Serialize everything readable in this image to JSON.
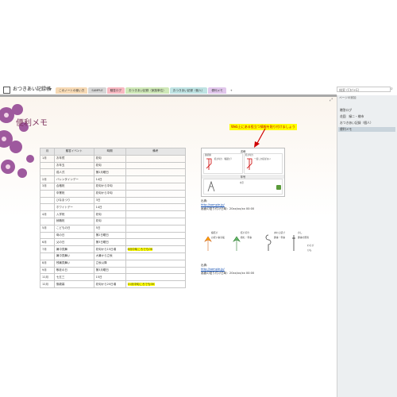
{
  "notebook": {
    "title": "おつきあい記録帳"
  },
  "tabs": [
    {
      "label": "このノートの使い方",
      "color": "#f6d9b4"
    },
    {
      "label": "SAMPLE",
      "color": "#d6d6d6"
    },
    {
      "label": "贈答ログ",
      "color": "#f7b8c1"
    },
    {
      "label": "おつきあい記録（家族単位）",
      "color": "#cfe8b8"
    },
    {
      "label": "おつきあい記録（個人）",
      "color": "#bfe3e3"
    },
    {
      "label": "便利メモ",
      "color": "#e1c7ec"
    },
    {
      "label": "+",
      "color": "#ffffff"
    }
  ],
  "search": {
    "placeholder": "検索 (Ctrl+E)"
  },
  "page": {
    "title": "便利メモ"
  },
  "events_table": {
    "headers": [
      "月",
      "贈答イベント",
      "時期",
      "備考"
    ],
    "rows": [
      [
        "1月",
        "お年賀",
        "初旬",
        ""
      ],
      [
        "",
        "お年玉",
        "初旬",
        ""
      ],
      [
        "",
        "成人式",
        "第2月曜日",
        ""
      ],
      [
        "2月",
        "バレンタインデー",
        "14日",
        ""
      ],
      [
        "3月",
        "合格祝",
        "初旬から中旬",
        ""
      ],
      [
        "",
        "卒業祝",
        "初旬から中旬",
        ""
      ],
      [
        "",
        "ひなまつり",
        "3日",
        ""
      ],
      [
        "",
        "ホワイトデー",
        "14日",
        ""
      ],
      [
        "4月",
        "入学祝",
        "初旬",
        ""
      ],
      [
        "",
        "就職祝",
        "初旬",
        ""
      ],
      [
        "5月",
        "こどもの日",
        "5日",
        ""
      ],
      [
        "",
        "母の日",
        "第2日曜日",
        ""
      ],
      [
        "6月",
        "父の日",
        "第3日曜日",
        ""
      ],
      [
        "7月",
        "暑中見舞",
        "初旬から15日頃",
        "6月中旬ころでもOK"
      ],
      [
        "",
        "暑中見舞い",
        "大暑から立秋",
        ""
      ],
      [
        "8月",
        "残暑見舞い",
        "立秋以降",
        ""
      ],
      [
        "9月",
        "敬老の日",
        "第3月曜日",
        ""
      ],
      [
        "11月",
        "七五三",
        "15日",
        ""
      ],
      [
        "12月",
        "御歳暮",
        "初旬から20日頃",
        "11月中旬ころでもOK"
      ]
    ]
  },
  "callout": {
    "text": "Web上にある役立つ情報を貼り付けましょう"
  },
  "card": {
    "header": "書様",
    "sub_header": "年号",
    "cells": [
      {
        "title": "連続線",
        "body": "結び切り（蝶結び）"
      },
      {
        "title": "結び切り",
        "body": "一度しか結ばない"
      },
      {
        "title": "",
        "body": "水引"
      }
    ]
  },
  "source1": {
    "label": "出典:",
    "url": "http://sample.jp/",
    "date": "画面の貼り付け日時：20xx/xx/xx 00:00"
  },
  "source2": {
    "label": "出典:",
    "url": "http://sample.jp/",
    "date": "画面の貼り付け日時：20xx/xx/xx 00:00"
  },
  "mizuhiki": [
    {
      "name": "蝶結び",
      "note": "お祝い事全般"
    },
    {
      "name": "結び切り",
      "note": "婚礼・弔事"
    },
    {
      "name": "あわじ結び",
      "note": "慶事・弔事"
    },
    {
      "name": "のし",
      "note": "慶事の贈答"
    },
    {
      "name": "わらび",
      "note": "ひも"
    }
  ],
  "right_panel": {
    "add_page": "ページの追加",
    "pages": [
      "贈答ログ",
      "花園　緑二・様市",
      "おつきあい記録（個人）",
      "便利メモ"
    ],
    "selected_index": 3
  }
}
